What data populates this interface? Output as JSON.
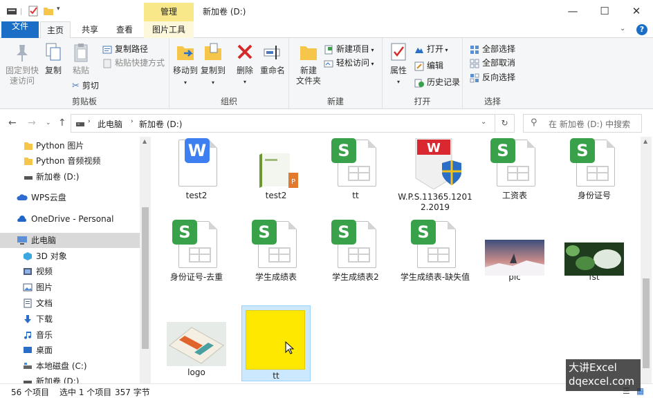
{
  "titlebar": {
    "context_tab": "管理",
    "title": "新加卷 (D:)",
    "minimize": "—",
    "maximize": "☐",
    "close": "✕"
  },
  "tabs": {
    "file": "文件",
    "home": "主页",
    "share": "共享",
    "view": "查看",
    "picture_tools": "图片工具"
  },
  "ribbon": {
    "clipboard": {
      "label": "剪贴板",
      "pin": "固定到快速访问",
      "pin_l1": "固定到快",
      "pin_l2": "速访问",
      "copy": "复制",
      "paste": "粘贴",
      "copy_path": "复制路径",
      "paste_shortcut": "粘贴快捷方式",
      "cut": "剪切"
    },
    "organize": {
      "label": "组织",
      "move_to": "移动到",
      "copy_to": "复制到",
      "delete": "删除",
      "rename": "重命名"
    },
    "new": {
      "label": "新建",
      "new_folder_l1": "新建",
      "new_folder_l2": "文件夹",
      "new_item": "新建项目",
      "easy_access": "轻松访问"
    },
    "open": {
      "label": "打开",
      "properties": "属性",
      "open": "打开",
      "edit": "编辑",
      "history": "历史记录"
    },
    "select": {
      "label": "选择",
      "select_all": "全部选择",
      "select_none": "全部取消",
      "invert": "反向选择"
    }
  },
  "address": {
    "crumbs": [
      "此电脑",
      "新加卷 (D:)"
    ],
    "search_placeholder": "在 新加卷 (D:) 中搜索"
  },
  "nav": [
    {
      "label": "Python 图片",
      "icon": "folder-icon"
    },
    {
      "label": "Python 音频视频",
      "icon": "folder-icon"
    },
    {
      "label": "新加卷 (D:)",
      "icon": "drive-icon"
    },
    {
      "label": "WPS云盘",
      "icon": "cloud-icon"
    },
    {
      "label": "OneDrive - Personal",
      "icon": "onedrive-icon"
    },
    {
      "label": "此电脑",
      "icon": "computer-icon"
    },
    {
      "label": "3D 对象",
      "icon": "cube-icon"
    },
    {
      "label": "视频",
      "icon": "video-icon"
    },
    {
      "label": "图片",
      "icon": "picture-icon"
    },
    {
      "label": "文档",
      "icon": "document-icon"
    },
    {
      "label": "下载",
      "icon": "download-icon"
    },
    {
      "label": "音乐",
      "icon": "music-icon"
    },
    {
      "label": "桌面",
      "icon": "desktop-icon"
    },
    {
      "label": "本地磁盘 (C:)",
      "icon": "drive-icon"
    },
    {
      "label": "新加卷 (D:)",
      "icon": "drive-icon"
    }
  ],
  "files": [
    {
      "name": "test2",
      "type": "wps-writer"
    },
    {
      "name": "test2",
      "type": "image-book"
    },
    {
      "name": "tt",
      "type": "wps-sheet"
    },
    {
      "name": "W.P.S.11365.12012.2019",
      "type": "installer"
    },
    {
      "name": "工资表",
      "type": "wps-sheet"
    },
    {
      "name": "身份证号",
      "type": "wps-sheet"
    },
    {
      "name": "身份证号-去重",
      "type": "wps-sheet"
    },
    {
      "name": "学生成绩表",
      "type": "wps-sheet"
    },
    {
      "name": "学生成绩表2",
      "type": "wps-sheet"
    },
    {
      "name": "学生成绩表-缺失值",
      "type": "wps-sheet"
    },
    {
      "name": "pic",
      "type": "photo-sky"
    },
    {
      "name": "fst",
      "type": "photo-green"
    },
    {
      "name": "logo",
      "type": "photo-book"
    },
    {
      "name": "tt",
      "type": "image-yellow"
    }
  ],
  "status": {
    "count": "56 个项目",
    "selected": "选中 1 个项目",
    "size": "357 字节"
  },
  "watermark": {
    "line1": "大讲Excel",
    "line2": "dqexcel.com"
  },
  "colors": {
    "file_tab": "#1a6ec6",
    "context_tab": "#f8e88a",
    "wps_sheet": "#3aa14b",
    "wps_writer": "#3d7ef0",
    "selection": "#cce8ff"
  }
}
